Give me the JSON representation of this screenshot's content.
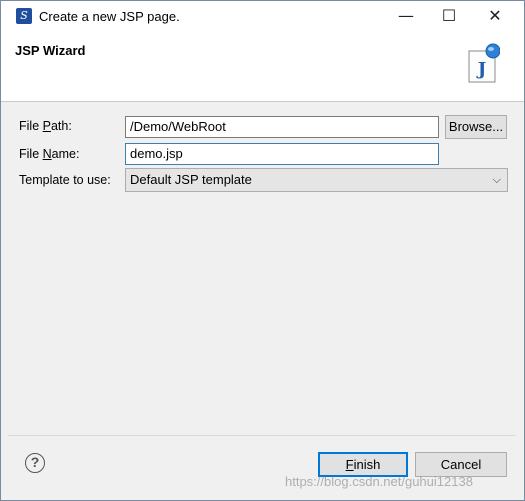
{
  "window": {
    "title": "Create a new JSP page.",
    "controls": {
      "minimize": "—",
      "maximize": "☐",
      "close": "✕"
    }
  },
  "header": {
    "title": "JSP Wizard",
    "icon_letter": "J"
  },
  "form": {
    "file_path": {
      "label_pre": "File ",
      "label_underline": "P",
      "label_post": "ath:",
      "value": "/Demo/WebRoot"
    },
    "browse_button": "Browse...",
    "file_name": {
      "label_pre": "File ",
      "label_underline": "N",
      "label_post": "ame:",
      "value": "demo.jsp"
    },
    "template": {
      "label": "Template to use:",
      "selected": "Default JSP template"
    }
  },
  "footer": {
    "help": "?",
    "finish": {
      "underline": "F",
      "rest": "inish"
    },
    "cancel": "Cancel"
  },
  "watermark": "https://blog.csdn.net/guhui12138"
}
